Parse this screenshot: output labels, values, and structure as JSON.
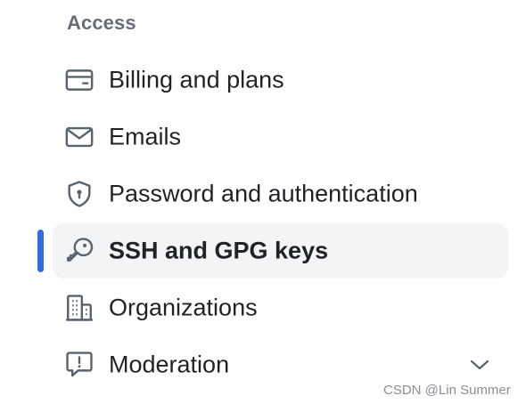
{
  "section": {
    "heading": "Access"
  },
  "nav": {
    "items": [
      {
        "label": "Billing and plans",
        "icon": "credit-card-icon"
      },
      {
        "label": "Emails",
        "icon": "mail-icon"
      },
      {
        "label": "Password and authentication",
        "icon": "shield-lock-icon"
      },
      {
        "label": "SSH and GPG keys",
        "icon": "key-icon",
        "active": true
      },
      {
        "label": "Organizations",
        "icon": "organization-icon"
      },
      {
        "label": "Moderation",
        "icon": "report-icon",
        "expandable": true
      }
    ]
  },
  "colors": {
    "active_indicator": "#2f6ee0",
    "active_background": "#f3f4f6",
    "heading": "#656d76",
    "text": "#1f2328"
  },
  "watermark": {
    "text": "CSDN @Lin Summer"
  }
}
